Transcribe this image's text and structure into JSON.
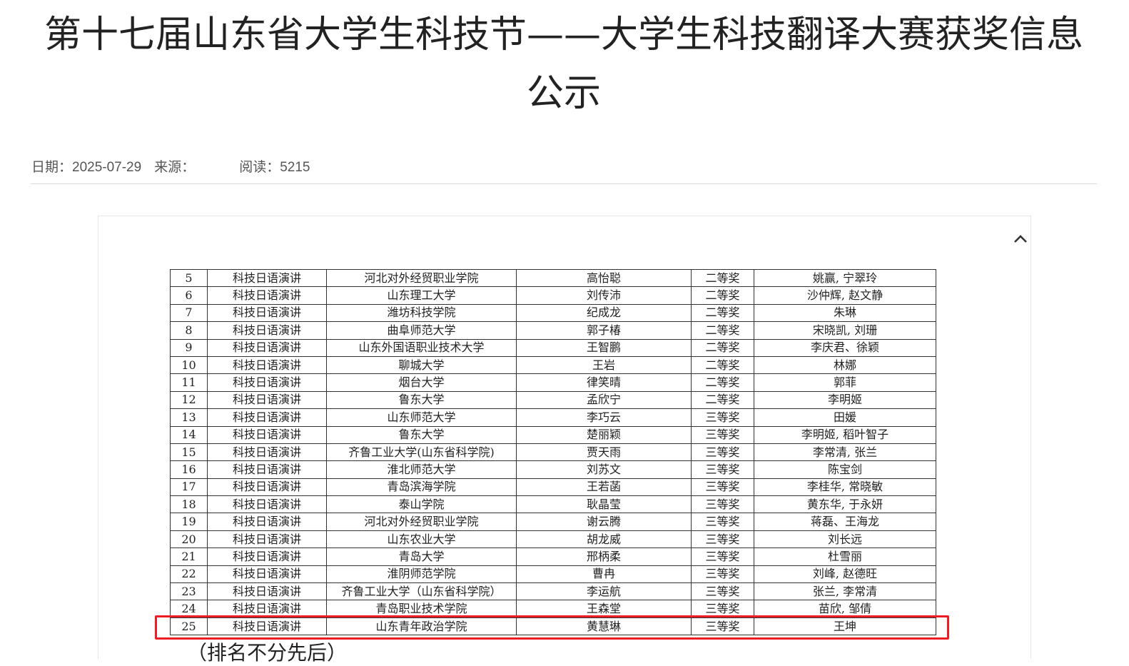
{
  "article": {
    "title": "第十七届山东省大学生科技节——大学生科技翻译大赛获奖信息公示",
    "date": "日期：2025-07-29",
    "source": "来源：",
    "reads": "阅读：5215"
  },
  "scroll_up_icon": "chevron-up-icon",
  "highlight_color": "#ee1c25",
  "table": {
    "rows": [
      [
        "5",
        "科技日语演讲",
        "河北对外经贸职业学院",
        "高怡聪",
        "二等奖",
        "姚赢, 宁翠玲"
      ],
      [
        "6",
        "科技日语演讲",
        "山东理工大学",
        "刘传沛",
        "二等奖",
        "沙仲辉, 赵文静"
      ],
      [
        "7",
        "科技日语演讲",
        "潍坊科技学院",
        "纪成龙",
        "二等奖",
        "朱琳"
      ],
      [
        "8",
        "科技日语演讲",
        "曲阜师范大学",
        "郭子椿",
        "二等奖",
        "宋晓凯, 刘珊"
      ],
      [
        "9",
        "科技日语演讲",
        "山东外国语职业技术大学",
        "王智鹏",
        "二等奖",
        "李庆君、徐颖"
      ],
      [
        "10",
        "科技日语演讲",
        "聊城大学",
        "王岩",
        "二等奖",
        "林娜"
      ],
      [
        "11",
        "科技日语演讲",
        "烟台大学",
        "律笑晴",
        "二等奖",
        "郭菲"
      ],
      [
        "12",
        "科技日语演讲",
        "鲁东大学",
        "孟欣宁",
        "二等奖",
        "李明姬"
      ],
      [
        "13",
        "科技日语演讲",
        "山东师范大学",
        "李巧云",
        "三等奖",
        "田媛"
      ],
      [
        "14",
        "科技日语演讲",
        "鲁东大学",
        "楚丽颖",
        "三等奖",
        "李明姬, 稻叶智子"
      ],
      [
        "15",
        "科技日语演讲",
        "齐鲁工业大学(山东省科学院)",
        "贾天雨",
        "三等奖",
        "李常清, 张兰"
      ],
      [
        "16",
        "科技日语演讲",
        "淮北师范大学",
        "刘苏文",
        "三等奖",
        "陈宝剑"
      ],
      [
        "17",
        "科技日语演讲",
        "青岛滨海学院",
        "王若菡",
        "三等奖",
        "李桂华, 常晓敏"
      ],
      [
        "18",
        "科技日语演讲",
        "泰山学院",
        "耿晶莹",
        "三等奖",
        "黄东华, 于永妍"
      ],
      [
        "19",
        "科技日语演讲",
        "河北对外经贸职业学院",
        "谢云腾",
        "三等奖",
        "蒋磊、王海龙"
      ],
      [
        "20",
        "科技日语演讲",
        "山东农业大学",
        "胡龙威",
        "三等奖",
        "刘长远"
      ],
      [
        "21",
        "科技日语演讲",
        "青岛大学",
        "邢柄柔",
        "三等奖",
        "杜雪丽"
      ],
      [
        "22",
        "科技日语演讲",
        "淮阴师范学院",
        "曹冉",
        "三等奖",
        "刘峰, 赵德旺"
      ],
      [
        "23",
        "科技日语演讲",
        "齐鲁工业大学（山东省科学院）",
        "李运航",
        "三等奖",
        "张兰, 李常清"
      ],
      [
        "24",
        "科技日语演讲",
        "青岛职业技术学院",
        "王森堂",
        "三等奖",
        "苗欣, 邹倩"
      ],
      [
        "25",
        "科技日语演讲",
        "山东青年政治学院",
        "黄慧琳",
        "三等奖",
        "王坤"
      ]
    ]
  },
  "footer_note": "（排名不分先后）"
}
